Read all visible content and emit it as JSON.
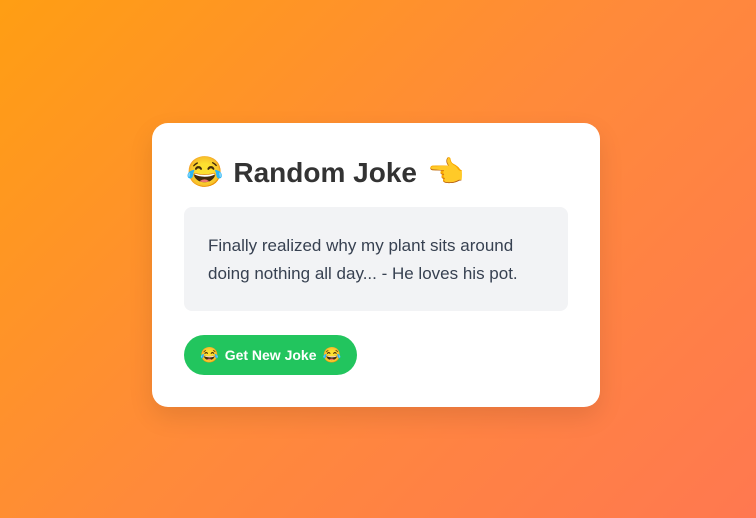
{
  "card": {
    "title": "Random Joke",
    "title_icon_left": "😂",
    "title_icon_right": "👈",
    "joke": "Finally realized why my plant sits around doing nothing all day... - He loves his pot.",
    "button": {
      "label": "Get New Joke",
      "icon_left": "😂",
      "icon_right": "😂"
    }
  },
  "colors": {
    "background_start": "#ff9e13",
    "background_end": "#ff7850",
    "button": "#22c55e",
    "joke_box": "#f2f3f5"
  }
}
